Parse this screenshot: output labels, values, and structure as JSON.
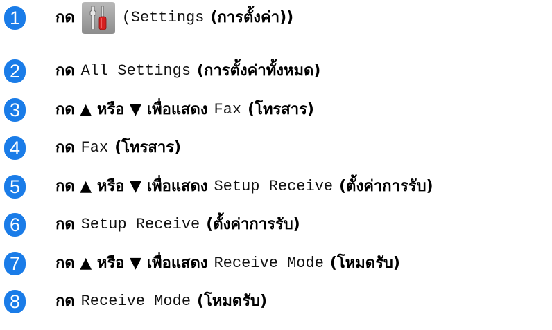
{
  "steps": [
    {
      "number": "1",
      "action": "กด",
      "icon": "settings-tools-icon",
      "button": "(Settings",
      "label": "(การตั้งค่า))"
    },
    {
      "number": "2",
      "action": "กด",
      "button": "All Settings",
      "label": "(การตั้งค่าทั้งหมด)"
    },
    {
      "number": "3",
      "action": "กด ▲ หรือ ▼ เพื่อแสดง",
      "button": "Fax",
      "label": "(โทรสาร)"
    },
    {
      "number": "4",
      "action": "กด",
      "button": "Fax",
      "label": "(โทรสาร)"
    },
    {
      "number": "5",
      "action": "กด ▲ หรือ ▼ เพื่อแสดง",
      "button": "Setup Receive",
      "label": "(ตั้งค่าการรับ)"
    },
    {
      "number": "6",
      "action": "กด",
      "button": "Setup Receive",
      "label": "(ตั้งค่าการรับ)"
    },
    {
      "number": "7",
      "action": "กด ▲ หรือ ▼ เพื่อแสดง",
      "button": "Receive Mode",
      "label": "(โหมดรับ)"
    },
    {
      "number": "8",
      "action": "กด",
      "button": "Receive Mode",
      "label": "(โหมดรับ)"
    }
  ],
  "colors": {
    "step_badge": "#1a7ce8",
    "icon_background": "#a3a3a3",
    "screwdriver_handle": "#d62020"
  }
}
